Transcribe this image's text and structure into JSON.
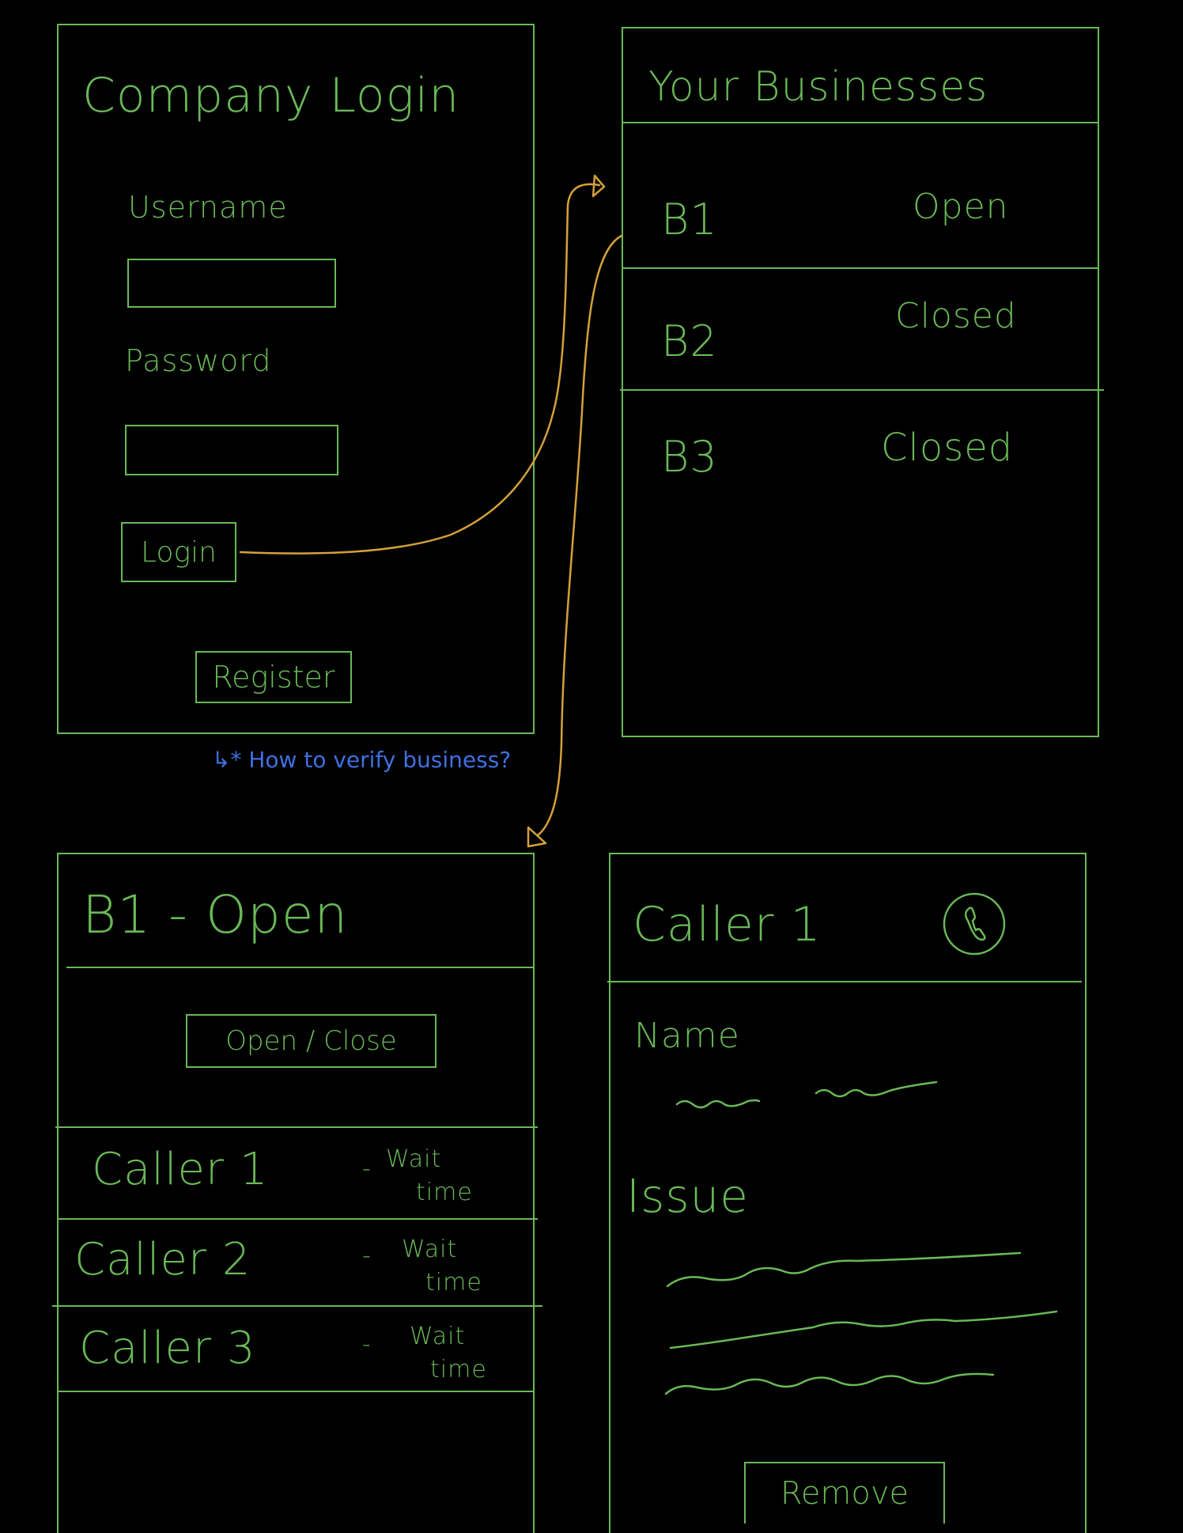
{
  "colors": {
    "background": "#000000",
    "ink": "#69b857",
    "arrow": "#d4a13a",
    "note": "#3f6fe0"
  },
  "login": {
    "title": "Company Login",
    "username_label": "Username",
    "password_label": "Password",
    "login_button": "Login",
    "register_button": "Register",
    "note": "↳* How to verify business?"
  },
  "businesses": {
    "title": "Your Businesses",
    "items": [
      {
        "name": "B1",
        "status": "Open"
      },
      {
        "name": "B2",
        "status": "Closed"
      },
      {
        "name": "B3",
        "status": "Closed"
      }
    ]
  },
  "business_detail": {
    "title": "B1 - Open",
    "toggle_button": "Open / Close",
    "callers": [
      {
        "name": "Caller 1",
        "dash": "-",
        "wait_line1": "Wait",
        "wait_line2": "time"
      },
      {
        "name": "Caller 2",
        "dash": "-",
        "wait_line1": "Wait",
        "wait_line2": "time"
      },
      {
        "name": "Caller 3",
        "dash": "-",
        "wait_line1": "Wait",
        "wait_line2": "time"
      }
    ]
  },
  "caller_detail": {
    "title": "Caller 1",
    "icon": "phone-icon",
    "name_label": "Name",
    "issue_label": "Issue",
    "remove_button": "Remove"
  }
}
